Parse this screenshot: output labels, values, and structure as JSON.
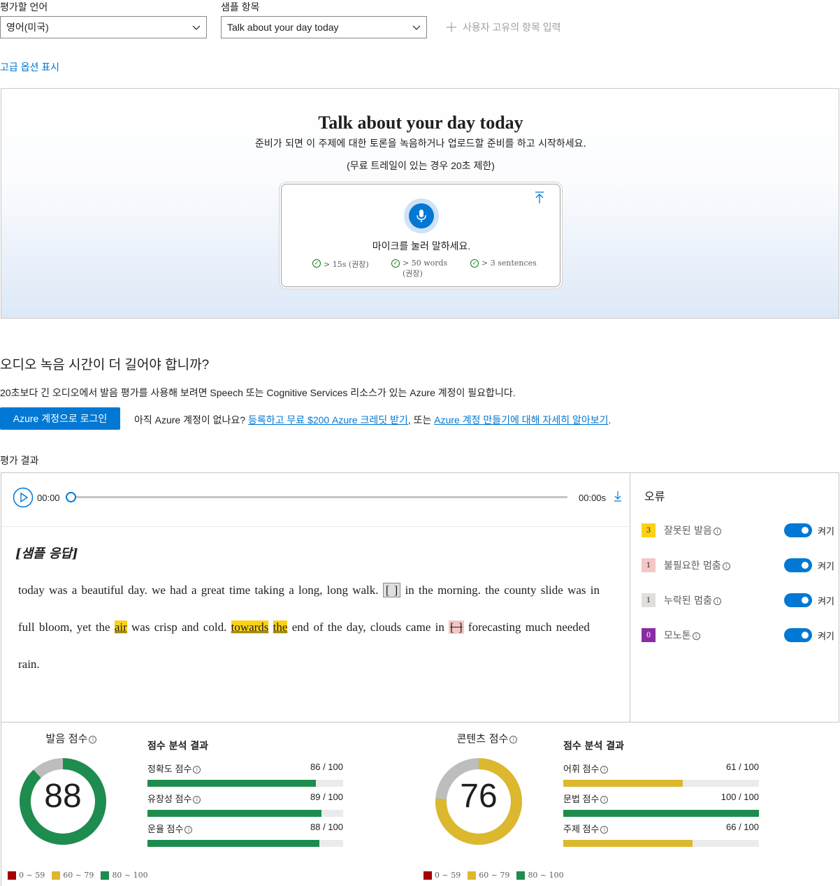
{
  "controls": {
    "language_label": "평가할 언어",
    "language_value": "영어(미국)",
    "sample_label": "샘플 항목",
    "sample_value": "Talk about your day today",
    "custom_topic": "사용자 고유의 항목 입력",
    "advanced": "고급 옵션 표시"
  },
  "hero": {
    "title": "Talk about your day today",
    "subtitle": "준비가 되면 이 주제에 대한 토론을 녹음하거나 업로드할 준비를 하고 시작하세요.",
    "trial": "(무료 트레일이 있는 경우 20초 제한)",
    "mic_prompt": "마이크를 눌러 말하세요.",
    "req1": "> 15s (권장)",
    "req2": "> 50 words (권장)",
    "req3": "> 3 sentences"
  },
  "longer": {
    "heading": "오디오 녹음 시간이 더 길어야 합니까?",
    "desc": "20초보다 긴 오디오에서 발음 평가를 사용해 보려면 Speech 또는 Cognitive Services 리소스가 있는 Azure 계정이 필요합니다.",
    "login_button": "Azure 계정으로 로그인",
    "no_account": "아직 Azure 계정이 없나요? ",
    "signup_link": "등록하고 무료 $200 Azure 크레딧 받기",
    "or_text": ", 또는 ",
    "learn_link": "Azure 계정 만들기에 대해 자세히 알아보기",
    "period": "."
  },
  "results": {
    "label": "평가 결과",
    "time_start": "00:00",
    "time_end": "00:00s",
    "sample_heading": "[샘플 응답]",
    "text": {
      "p1": "today was a beautiful day. we had a great time taking a long, long walk. ",
      "gap1": "[ ]",
      "p2": " in the morning. the county slide was in full bloom, yet the ",
      "w_air": "air",
      "p3": " was crisp and cold. ",
      "w_towards": "towards",
      "p4": " ",
      "w_the": "the",
      "p5": " end of the day, clouds came in ",
      "gap2": "[ ]",
      "p6": " forecasting much needed rain."
    }
  },
  "errors": {
    "title": "오류",
    "toggle_on": "켜기",
    "items": [
      {
        "count": "3",
        "label": "잘못된 발음",
        "color": "#fcd116",
        "text_color": "#201f1e"
      },
      {
        "count": "1",
        "label": "불필요한 멈춤",
        "color": "#f4c7c5",
        "text_color": "#201f1e"
      },
      {
        "count": "1",
        "label": "누락된 멈춤",
        "color": "#e1dfdd",
        "text_color": "#201f1e"
      },
      {
        "count": "0",
        "label": "모노톤",
        "color": "#8a2da5",
        "text_color": "#ffffff"
      }
    ]
  },
  "pronunciation": {
    "title": "발음 점수",
    "score": "88",
    "score_value": 88,
    "breakdown_title": "점수 분석 결과",
    "metrics": [
      {
        "label": "정확도 점수",
        "value": "86 / 100",
        "pct": 86
      },
      {
        "label": "유창성 점수",
        "value": "89 / 100",
        "pct": 89
      },
      {
        "label": "운율 점수",
        "value": "88 / 100",
        "pct": 88
      }
    ],
    "color": "#1e8c4e"
  },
  "content": {
    "title": "콘텐츠 점수",
    "score": "76",
    "score_value": 76,
    "breakdown_title": "점수 분석 결과",
    "metrics": [
      {
        "label": "어휘 점수",
        "value": "61 / 100",
        "pct": 61,
        "color": "#dcb82e"
      },
      {
        "label": "문법 점수",
        "value": "100 / 100",
        "pct": 100,
        "color": "#1e8c4e"
      },
      {
        "label": "주제 점수",
        "value": "66 / 100",
        "pct": 66,
        "color": "#dcb82e"
      }
    ],
    "color": "#dcb82e"
  },
  "legend": [
    {
      "label": "0 ~ 59",
      "color": "#a80000"
    },
    {
      "label": "60 ~ 79",
      "color": "#dcb82e"
    },
    {
      "label": "80 ~ 100",
      "color": "#1e8c4e"
    }
  ],
  "colors": {
    "accent": "#0078d4",
    "remaining": "#bdbdbd"
  }
}
